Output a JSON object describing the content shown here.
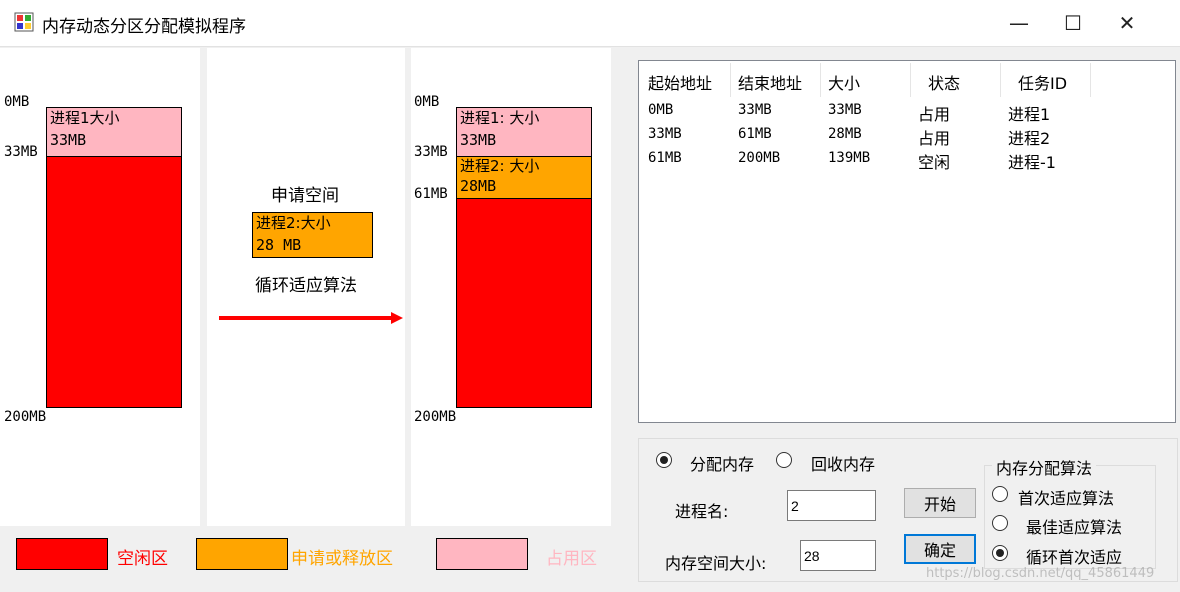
{
  "window": {
    "title": "内存动态分区分配模拟程序",
    "min": "—",
    "max": "☐",
    "close": "✕"
  },
  "left_diagram": {
    "axis": {
      "top": "0MB",
      "mid": "33MB",
      "bottom": "200MB"
    },
    "proc_label": "进程1大小",
    "proc_size": "33MB"
  },
  "middle": {
    "request_title": "申请空间",
    "req_line1": "进程2:大小",
    "req_line2": "28 MB",
    "algorithm": "循环适应算法"
  },
  "right_diagram": {
    "axis": {
      "top": "0MB",
      "m1": "33MB",
      "m2": "61MB",
      "bottom": "200MB"
    },
    "p1_label": "进程1: 大小",
    "p1_size": "33MB",
    "p2_label": "进程2: 大小",
    "p2_size": "28MB"
  },
  "table": {
    "columns": [
      "起始地址",
      "结束地址",
      "大小",
      "状态",
      "任务ID"
    ],
    "rows": [
      [
        "0MB",
        "33MB",
        "33MB",
        "占用",
        "进程1"
      ],
      [
        "33MB",
        "61MB",
        "28MB",
        "占用",
        "进程2"
      ],
      [
        "61MB",
        "200MB",
        "139MB",
        "空闲",
        "进程-1"
      ]
    ]
  },
  "controls": {
    "mode_alloc": "分配内存",
    "mode_free": "回收内存",
    "proc_name_label": "进程名:",
    "proc_name_value": "2",
    "mem_size_label": "内存空间大小:",
    "mem_size_value": "28",
    "start_button": "开始",
    "confirm_button": "确定",
    "algo_group_title": "内存分配算法",
    "algo_first": "首次适应算法",
    "algo_best": "最佳适应算法",
    "algo_next": "循环首次适应"
  },
  "legend": {
    "free": "空闲区",
    "request": "申请或释放区",
    "used": "占用区"
  },
  "watermark": "https://blog.csdn.net/qq_45861449",
  "colors": {
    "free": "#ff0000",
    "request": "#ffa500",
    "used": "#ffb6c1",
    "arrow": "#ff0000"
  }
}
